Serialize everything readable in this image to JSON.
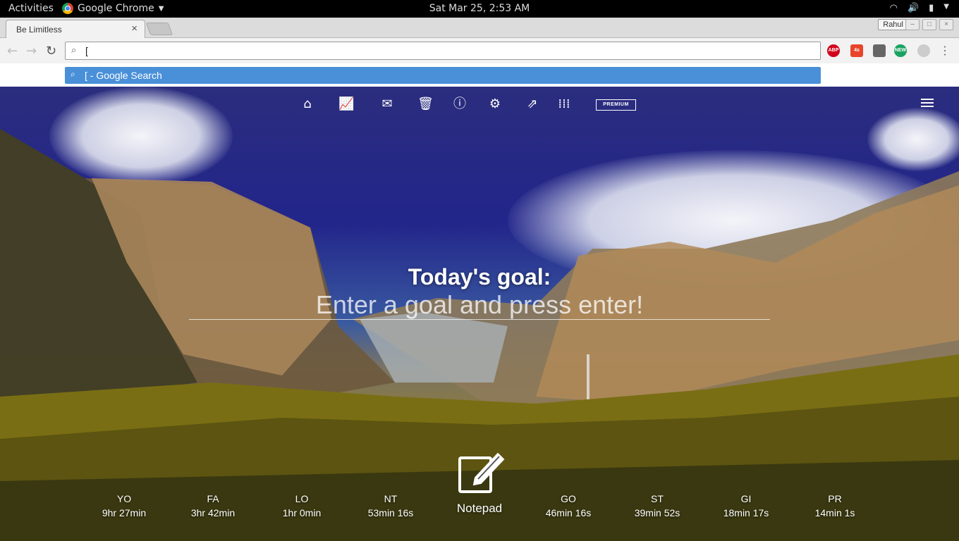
{
  "topbar": {
    "activities": "Activities",
    "app_name": "Google Chrome",
    "clock": "Sat Mar 25,  2:53 AM"
  },
  "chrome": {
    "tab_title": "Be Limitless",
    "profile_name": "Rahul",
    "omnibox_value": "[",
    "suggestion": "[ - Google Search",
    "extensions": [
      {
        "name": "ABP",
        "color": "#d0021b"
      },
      {
        "name": "4s",
        "color": "#e8442b"
      },
      {
        "name": "",
        "color": "#666666"
      },
      {
        "name": "NEW",
        "color": "#1aa260"
      },
      {
        "name": "",
        "color": "#cccccc"
      }
    ]
  },
  "page": {
    "nav_icons": [
      "home-icon",
      "chart-icon",
      "mail-icon",
      "trash-icon",
      "info-icon",
      "gear-icon",
      "share-icon",
      "apps-grid-icon"
    ],
    "premium_label": "PREMIUM",
    "goal_title": "Today's goal:",
    "goal_placeholder": "Enter a goal and press enter!",
    "notepad_label": "Notepad",
    "stats": [
      {
        "code": "YO",
        "time": "9hr 27min"
      },
      {
        "code": "FA",
        "time": "3hr 42min"
      },
      {
        "code": "LO",
        "time": "1hr 0min"
      },
      {
        "code": "NT",
        "time": "53min 16s"
      },
      {
        "code": "GO",
        "time": "46min 16s"
      },
      {
        "code": "ST",
        "time": "39min 52s"
      },
      {
        "code": "GI",
        "time": "18min 17s"
      },
      {
        "code": "PR",
        "time": "14min 1s"
      }
    ]
  }
}
